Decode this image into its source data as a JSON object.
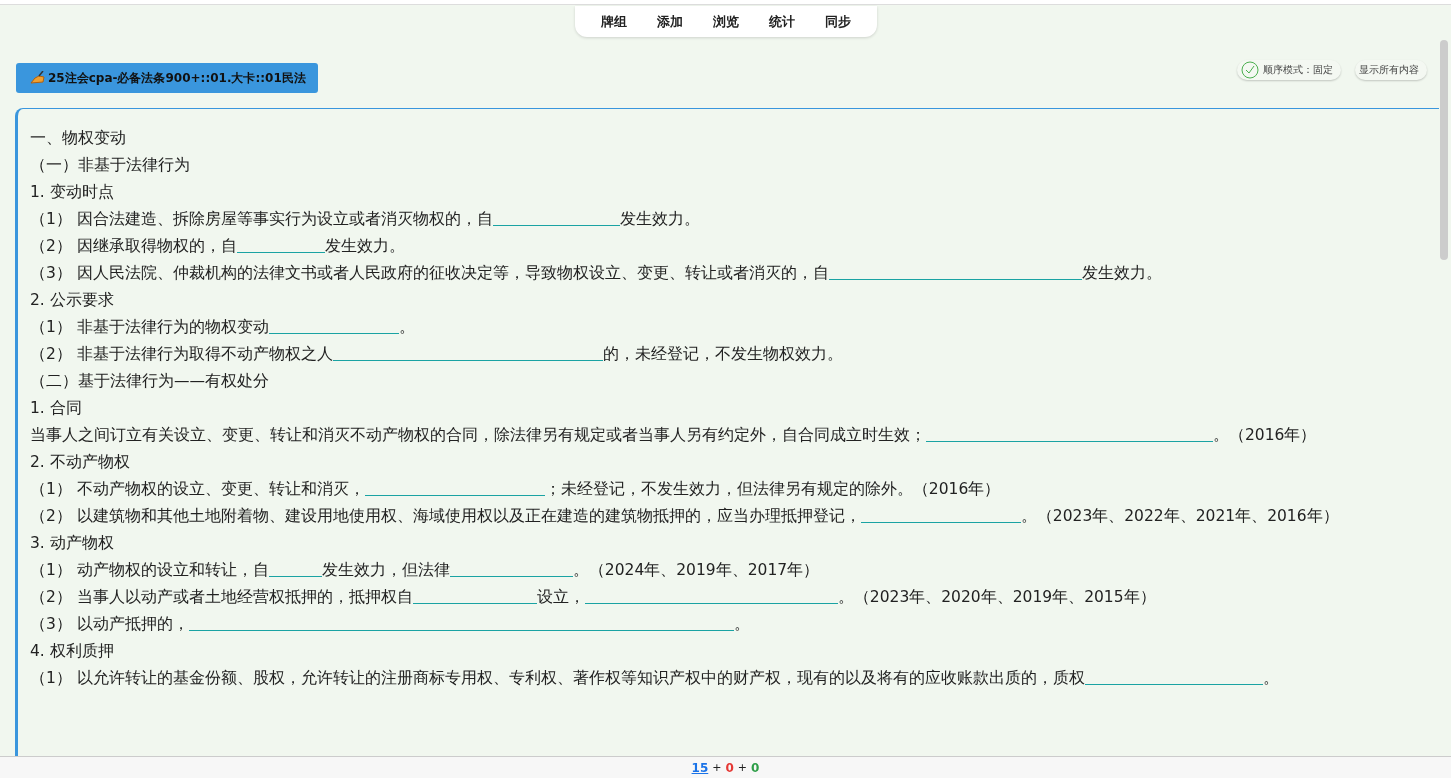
{
  "nav": [
    {
      "label": "牌组"
    },
    {
      "label": "添加"
    },
    {
      "label": "浏览"
    },
    {
      "label": "统计"
    },
    {
      "label": "同步"
    }
  ],
  "deck_title": "25注会cpa-必备法条900+::01.大卡::01民法",
  "mode_button": "顺序模式：固定",
  "show_all_button": "显示所有内容",
  "lines": [
    [
      {
        "kind": "text",
        "text": "一、物权变动"
      }
    ],
    [
      {
        "kind": "text",
        "text": "（一）非基于法律行为"
      }
    ],
    [
      {
        "kind": "text",
        "text": "1. 变动时点"
      }
    ],
    [
      {
        "kind": "text",
        "text": "（1） 因合法建造、拆除房屋等事实行为设立或者消灭物权的，自"
      },
      {
        "kind": "blank"
      },
      {
        "kind": "text",
        "text": "发生效力。"
      }
    ],
    [
      {
        "kind": "text",
        "text": "（2） 因继承取得物权的，自"
      },
      {
        "kind": "blank"
      },
      {
        "kind": "text",
        "text": "发生效力。"
      }
    ],
    [
      {
        "kind": "text",
        "text": "（3） 因人民法院、仲裁机构的法律文书或者人民政府的征收决定等，导致物权设立、变更、转让或者消灭的，自"
      },
      {
        "kind": "blank"
      },
      {
        "kind": "text",
        "text": "发生效力。"
      }
    ],
    [
      {
        "kind": "text",
        "text": "2. 公示要求"
      }
    ],
    [
      {
        "kind": "text",
        "text": "（1） 非基于法律行为的物权变动"
      },
      {
        "kind": "blank"
      },
      {
        "kind": "text",
        "text": "。"
      }
    ],
    [
      {
        "kind": "text",
        "text": "（2） 非基于法律行为取得不动产物权之人"
      },
      {
        "kind": "blank"
      },
      {
        "kind": "text",
        "text": "的，未经登记，不发生物权效力。"
      }
    ],
    [
      {
        "kind": "text",
        "text": "（二）基于法律行为——有权处分"
      }
    ],
    [
      {
        "kind": "text",
        "text": "1. 合同"
      }
    ],
    [
      {
        "kind": "text",
        "text": "当事人之间订立有关设立、变更、转让和消灭不动产物权的合同，除法律另有规定或者当事人另有约定外，自合同成立时生效；"
      },
      {
        "kind": "blank"
      },
      {
        "kind": "text",
        "text": "。（2016年）"
      }
    ],
    [
      {
        "kind": "text",
        "text": "2. 不动产物权"
      }
    ],
    [
      {
        "kind": "text",
        "text": "（1） 不动产物权的设立、变更、转让和消灭，"
      },
      {
        "kind": "blank"
      },
      {
        "kind": "text",
        "text": "；未经登记，不发生效力，但法律另有规定的除外。（2016年）"
      }
    ],
    [
      {
        "kind": "text",
        "text": "（2） 以建筑物和其他土地附着物、建设用地使用权、海域使用权以及正在建造的建筑物抵押的，应当办理抵押登记，"
      },
      {
        "kind": "blank"
      },
      {
        "kind": "text",
        "text": "。（2023年、2022年、2021年、2016年）"
      }
    ],
    [
      {
        "kind": "text",
        "text": "3. 动产物权"
      }
    ],
    [
      {
        "kind": "text",
        "text": "（1） 动产物权的设立和转让，自"
      },
      {
        "kind": "blank"
      },
      {
        "kind": "text",
        "text": "发生效力，但法律"
      },
      {
        "kind": "blank"
      },
      {
        "kind": "text",
        "text": "。（2024年、2019年、2017年）"
      }
    ],
    [
      {
        "kind": "text",
        "text": "（2） 当事人以动产或者土地经营权抵押的，抵押权自"
      },
      {
        "kind": "blank"
      },
      {
        "kind": "text",
        "text": "设立，"
      },
      {
        "kind": "blank"
      },
      {
        "kind": "text",
        "text": "。（2023年、2020年、2019年、2015年）"
      }
    ],
    [
      {
        "kind": "text",
        "text": "（3） 以动产抵押的，"
      },
      {
        "kind": "blank"
      },
      {
        "kind": "text",
        "text": "。"
      }
    ],
    [
      {
        "kind": "text",
        "text": "4. 权利质押"
      }
    ],
    [
      {
        "kind": "text",
        "text": "（1） 以允许转让的基金份额、股权，允许转让的注册商标专用权、专利权、著作权等知识产权中的财产权，现有的以及将有的应收账款出质的，质权"
      },
      {
        "kind": "blank"
      },
      {
        "kind": "text",
        "text": "。"
      }
    ]
  ],
  "counts": [
    {
      "text": "15",
      "color": "#1a73e8"
    },
    {
      "text": "0",
      "color": "#e53935"
    },
    {
      "text": "0",
      "color": "#2e9e48"
    }
  ],
  "count_separators": [
    "+",
    "+"
  ]
}
